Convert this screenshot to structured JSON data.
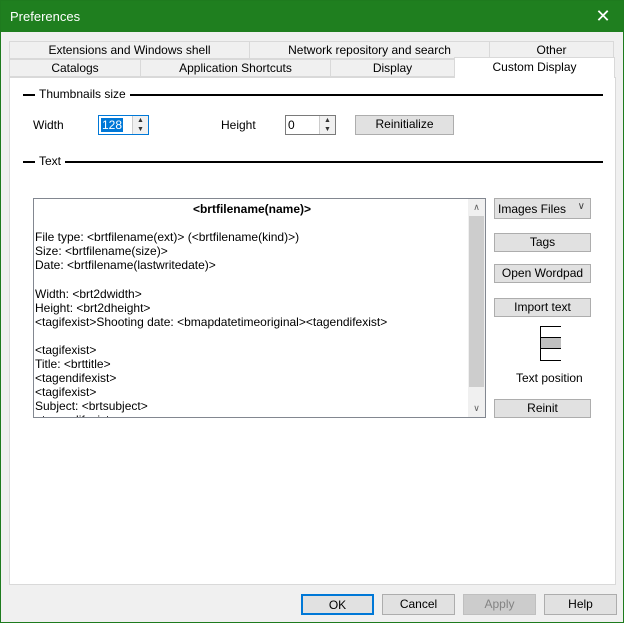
{
  "window": {
    "title": "Preferences",
    "close_icon": "close-icon"
  },
  "tabs_row1": [
    {
      "label": "Extensions and Windows shell"
    },
    {
      "label": "Network repository and search"
    },
    {
      "label": "Other"
    }
  ],
  "tabs_row2": [
    {
      "label": "Catalogs"
    },
    {
      "label": "Application Shortcuts"
    },
    {
      "label": "Display"
    },
    {
      "label": "Custom Display",
      "selected": true
    }
  ],
  "thumbnails": {
    "group_label": "Thumbnails size",
    "width_label": "Width",
    "width_value": "128",
    "height_label": "Height",
    "height_value": "0",
    "reinit_label": "Reinitialize"
  },
  "text": {
    "group_label": "Text",
    "lines": [
      "<brtfilename(name)>",
      "",
      "File type: <brtfilename(ext)> (<brtfilename(kind)>)",
      "Size: <brtfilename(size)>",
      "Date: <brtfilename(lastwritedate)>",
      "",
      "Width: <brt2dwidth>",
      "Height: <brt2dheight>",
      "<tagifexist>Shooting date: <bmapdatetimeoriginal><tagendifexist>",
      "",
      "<tagifexist>",
      "Title: <brttitle>",
      "<tagendifexist>",
      "<tagifexist>",
      "Subject: <brtsubject>",
      "<tagendifexist>"
    ],
    "file_type_select": "Images Files",
    "tags_label": "Tags",
    "wordpad_label": "Open Wordpad",
    "import_label": "Import text",
    "position_label": "Text position",
    "position_selected": "middle",
    "reinit_label": "Reinit"
  },
  "footer": {
    "ok": "OK",
    "cancel": "Cancel",
    "apply": "Apply",
    "help": "Help"
  },
  "colors": {
    "titlebar": "#1f7f1f",
    "focus": "#0078d7"
  }
}
